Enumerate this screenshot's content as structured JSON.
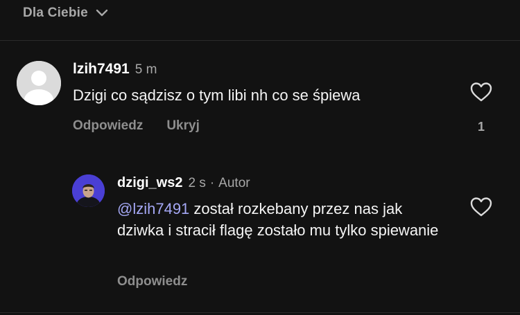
{
  "filter": {
    "label": "Dla Ciebie",
    "chevron_icon": "chevron-down-icon"
  },
  "comment": {
    "username": "lzih7491",
    "time": "5 m",
    "text": "Dzigi co sądzisz o tym libi nh co se śpiewa",
    "reply_label": "Odpowiedz",
    "hide_label": "Ukryj",
    "like_count": "1",
    "avatar_icon": "default-avatar-icon",
    "like_icon": "heart-outline-icon"
  },
  "reply": {
    "username": "dzigi_ws2",
    "time": "2 s",
    "separator": "·",
    "author_tag": "Autor",
    "mention": "@lzih7491",
    "text": " został rozkebany przez nas jak dziwka i stracił flagę zostało mu tylko spiewanie",
    "reply_label": "Odpowiedz",
    "like_icon": "heart-outline-icon"
  },
  "colors": {
    "background": "#121212",
    "secondary_text": "#a8a8a8",
    "mention": "#a5a8f5",
    "avatar_bg": "#4a3fd4"
  }
}
